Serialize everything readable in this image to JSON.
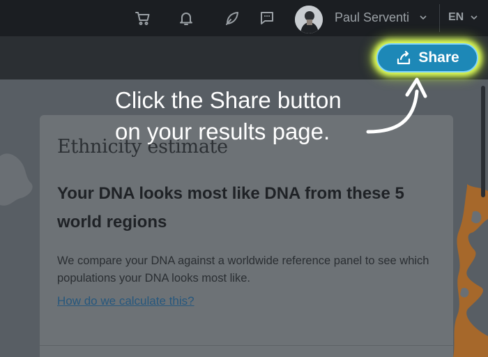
{
  "topbar": {
    "icons": [
      "cart-icon",
      "bell-icon",
      "leaf-icon",
      "chat-icon"
    ],
    "user_name": "Paul Serventi",
    "language": "EN"
  },
  "header": {
    "share_label": "Share"
  },
  "annotation": {
    "line1": "Click the Share button",
    "line2": "on your results page."
  },
  "card": {
    "title": "Ethnicity estimate",
    "heading": "Your DNA looks most like DNA from these 5 world regions",
    "body": "We compare your DNA against a worldwide reference panel to see which populations your DNA looks most like.",
    "link": "How do we calculate this?"
  },
  "colors": {
    "share_button": "#1d88b7",
    "share_glow": "#e2ff5a",
    "topbar": "#1b1e22"
  }
}
